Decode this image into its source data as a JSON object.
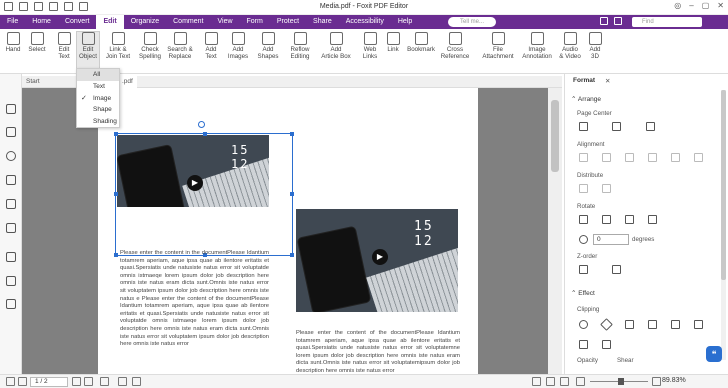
{
  "window": {
    "title": "Media.pdf - Foxit PDF Editor"
  },
  "menu": {
    "items": [
      "File",
      "Home",
      "Convert",
      "Edit",
      "Organize",
      "Comment",
      "View",
      "Form",
      "Protect",
      "Share",
      "Accessibility",
      "Help"
    ],
    "active": "Edit",
    "tell_me_placeholder": "Tell me...",
    "find_placeholder": "Find"
  },
  "ribbon": {
    "hand": "Hand",
    "select": "Select",
    "edit_text": "Edit\nText",
    "edit_object": "Edit\nObject",
    "link_join": "Link &\nJoin Text",
    "check_spelling": "Check\nSpelling",
    "search_replace": "Search &\nReplace",
    "add_text": "Add\nText",
    "add_images": "Add\nImages",
    "add_shapes": "Add\nShapes",
    "reflow": "Reflow\nEditing",
    "add_article": "Add\nArticle Box",
    "web_links": "Web\nLinks",
    "link": "Link",
    "bookmark": "Bookmark",
    "cross_ref": "Cross\nReference",
    "file_attachment": "File\nAttachment",
    "image_annotation": "Image\nAnnotation",
    "audio_video": "Audio\n& Video",
    "add_3d": "Add\n3D"
  },
  "edit_object_menu": {
    "items": [
      "All",
      "Text",
      "Image",
      "Shape",
      "Shading"
    ],
    "checked": "Image",
    "highlighted": "All"
  },
  "tabs": {
    "start": "Start",
    "doc": ".pdf"
  },
  "document": {
    "image1_digits": "15 12",
    "image2_digits": "15 12",
    "para1": "Please enter the content in the documentPlease Idantium totamrem aperiam, aque ipsa quae ab ilentore eritatis et quasi.Spersiatis unde natusiste natus error sit voluptatde omnis istmaeqe lorem ipsum dolor job description here omnis iste natus eram dicta sunt.Omnis iste natus error sit voluptatem ipsum dolor job description here omnis iste natus e Please enter the content of the documentPlease Idantium totamrem aperiam, aque ipsa quae ab ilentore eritatis et quasi.Spersiatis unde natusiste natus error sit voluptatde omnis istmaeqe lorem ipsum dolor job description here omnis iste natus eram dicta sunt.Omnis iste natus error sit voluptatem ipsum dolor job description here omnis iste natus error",
    "para2": "Please enter the content of the documentPlease Idantium totamrem aperiam, aque ipsa quae ab ilentore eritatis et quasi.Spersiatis unde natusiste natus error sit voluptatemne lorem ipsum dolor job description here omnis iste natus eram dicta sunt.Omnis iste natus error sit voluptatemipsum dolor job description here omnis iste natus error"
  },
  "format_panel": {
    "tab": "Format",
    "arrange": "Arrange",
    "page_center": "Page Center",
    "alignment": "Alignment",
    "distribute": "Distribute",
    "rotate": "Rotate",
    "angle_value": "0",
    "degrees": "degrees",
    "z_order": "Z-order",
    "effect": "Effect",
    "clipping": "Clipping",
    "opacity": "Opacity",
    "shear": "Shear"
  },
  "status": {
    "page": "1 / 2",
    "zoom": "89.83%"
  },
  "colors": {
    "accent": "#6a2c91",
    "selection": "#2b6ecf"
  }
}
